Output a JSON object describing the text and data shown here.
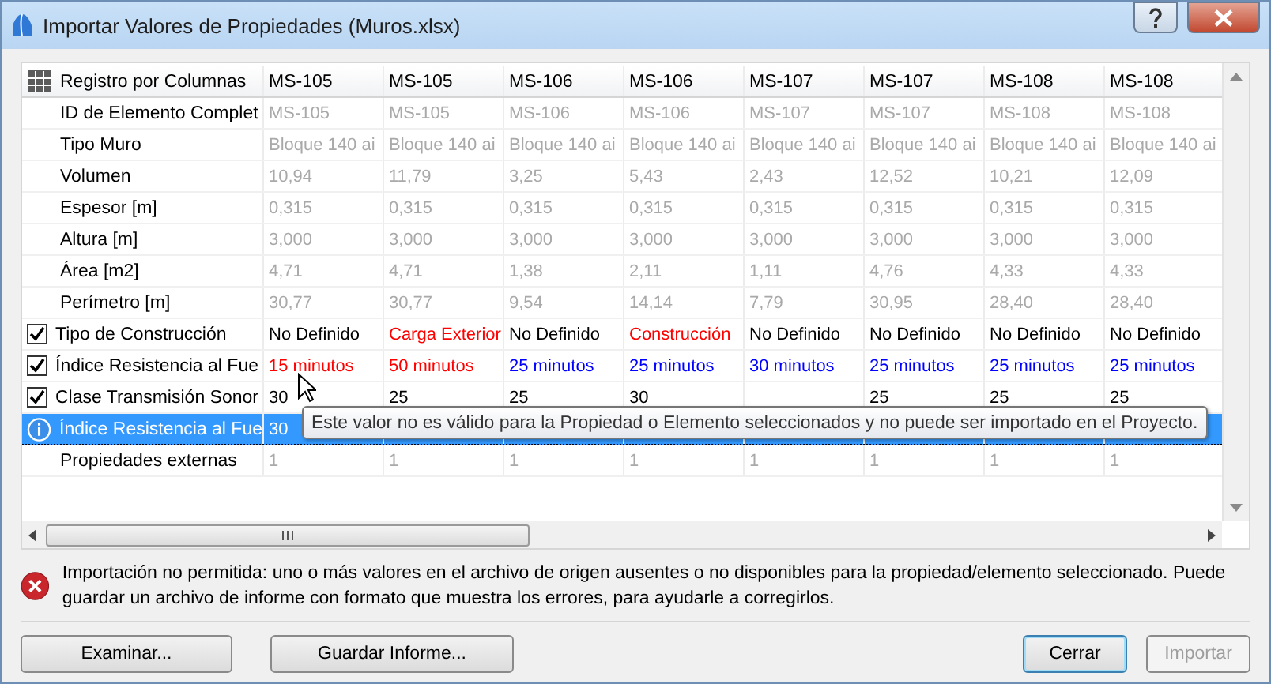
{
  "window": {
    "title": "Importar Valores de Propiedades (Muros.xlsx)"
  },
  "table": {
    "header": {
      "label": "Registro por Columnas",
      "columns": [
        "MS-105",
        "MS-105",
        "MS-106",
        "MS-106",
        "MS-107",
        "MS-107",
        "MS-108",
        "MS-108"
      ]
    },
    "rows": [
      {
        "kind": "readonly",
        "label": "ID de Elemento Complet",
        "cells": [
          "MS-105",
          "MS-105",
          "MS-106",
          "MS-106",
          "MS-107",
          "MS-107",
          "MS-108",
          "MS-108"
        ]
      },
      {
        "kind": "readonly",
        "label": "Tipo Muro",
        "cells": [
          "Bloque 140 ai",
          "Bloque 140 ai",
          "Bloque 140 ai",
          "Bloque 140 ai",
          "Bloque 140 ai",
          "Bloque 140 ai",
          "Bloque 140 ai",
          "Bloque 140 ai"
        ]
      },
      {
        "kind": "readonly",
        "label": "Volumen",
        "cells": [
          "10,94",
          "11,79",
          "3,25",
          "5,43",
          "2,43",
          "12,52",
          "10,21",
          "12,09"
        ]
      },
      {
        "kind": "readonly",
        "label": "Espesor [m]",
        "cells": [
          "0,315",
          "0,315",
          "0,315",
          "0,315",
          "0,315",
          "0,315",
          "0,315",
          "0,315"
        ]
      },
      {
        "kind": "readonly",
        "label": "Altura [m]",
        "cells": [
          "3,000",
          "3,000",
          "3,000",
          "3,000",
          "3,000",
          "3,000",
          "3,000",
          "3,000"
        ]
      },
      {
        "kind": "readonly",
        "label": "Área [m2]",
        "cells": [
          "4,71",
          "4,71",
          "1,38",
          "2,11",
          "1,11",
          "4,76",
          "4,33",
          "4,33"
        ]
      },
      {
        "kind": "readonly",
        "label": "Perímetro [m]",
        "cells": [
          "30,77",
          "30,77",
          "9,54",
          "14,14",
          "7,79",
          "30,95",
          "28,40",
          "28,40"
        ]
      },
      {
        "kind": "checkbox",
        "checked": true,
        "selected": false,
        "label": "Tipo de Construcción",
        "cells": [
          {
            "text": "No Definido",
            "color": "#000000"
          },
          {
            "text": "Carga Exterior",
            "color": "#ff0000"
          },
          {
            "text": "No Definido",
            "color": "#000000"
          },
          {
            "text": "Construcción",
            "color": "#ff0000"
          },
          {
            "text": "No Definido",
            "color": "#000000"
          },
          {
            "text": "No Definido",
            "color": "#000000"
          },
          {
            "text": "No Definido",
            "color": "#000000"
          },
          {
            "text": "No Definido",
            "color": "#000000"
          }
        ]
      },
      {
        "kind": "checkbox",
        "checked": true,
        "selected": false,
        "label": "Índice Resistencia al Fue",
        "cells": [
          {
            "text": "15 minutos",
            "color": "#ff0000"
          },
          {
            "text": "50 minutos",
            "color": "#ff0000"
          },
          {
            "text": "25 minutos",
            "color": "#0000ff"
          },
          {
            "text": "25 minutos",
            "color": "#0000ff"
          },
          {
            "text": "30 minutos",
            "color": "#0000ff"
          },
          {
            "text": "25 minutos",
            "color": "#0000ff"
          },
          {
            "text": "25 minutos",
            "color": "#0000ff"
          },
          {
            "text": "25 minutos",
            "color": "#0000ff"
          }
        ]
      },
      {
        "kind": "checkbox",
        "checked": true,
        "selected": false,
        "label": "Clase Transmisión Sonor",
        "cells": [
          {
            "text": "30",
            "color": "#000000"
          },
          {
            "text": "25",
            "color": "#000000"
          },
          {
            "text": "25",
            "color": "#000000"
          },
          {
            "text": "30",
            "color": "#000000"
          },
          null,
          {
            "text": "25",
            "color": "#000000"
          },
          {
            "text": "25",
            "color": "#000000"
          },
          {
            "text": "25",
            "color": "#000000"
          }
        ]
      },
      {
        "kind": "info",
        "selected": true,
        "label": "Índice Resistencia al Fue",
        "cells": [
          {
            "text": "30",
            "color": "#ffffff"
          }
        ]
      },
      {
        "kind": "readonly",
        "label": "Propiedades externas",
        "cells": [
          "1",
          "1",
          "1",
          "1",
          "1",
          "1",
          "1",
          "1"
        ]
      }
    ],
    "tooltip": "Este valor no es válido para la Propiedad o Elemento seleccionados y no puede ser importado en el Proyecto."
  },
  "message": "Importación no permitida: uno o más valores en el archivo de origen ausentes o no disponibles para la propiedad/elemento seleccionado. Puede guardar un archivo de informe con formato que muestra los errores, para ayudarle a corregirlos.",
  "buttons": [
    {
      "label": "Examinar...",
      "disabled": false,
      "default": false
    },
    {
      "label": "Guardar Informe...",
      "disabled": false,
      "default": false
    },
    {
      "label": "Cerrar",
      "disabled": false,
      "default": true
    },
    {
      "label": "Importar",
      "disabled": true,
      "default": false
    }
  ]
}
